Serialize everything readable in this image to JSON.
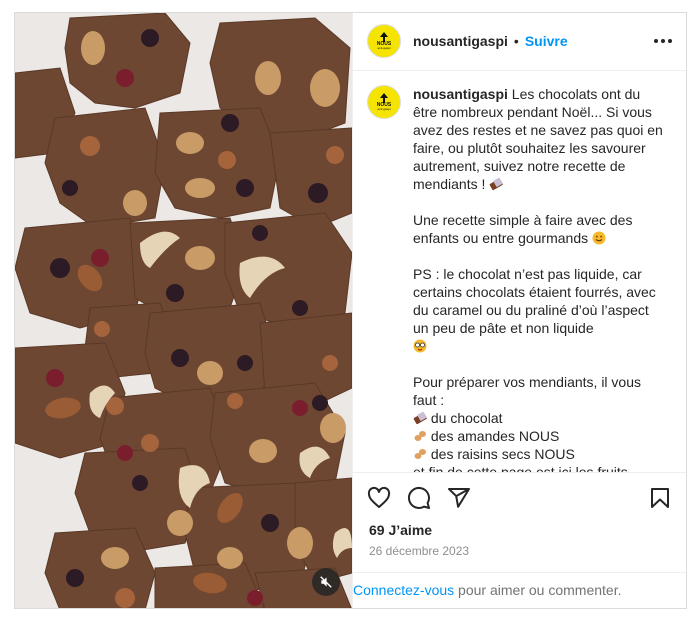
{
  "post": {
    "username": "nousantigaspi",
    "follow_label": "Suivre",
    "avatar_text": "NOUS",
    "avatar_subtext": "anti-gaspi",
    "caption_part1": "Les chocolats ont du être nombreux pendant Noël... Si vous avez des restes et ne savez pas quoi en faire, ou plutôt souhaitez les savourer autrement, suivez notre recette de mendiants ! ",
    "caption_part2": "Une recette simple à faire avec des enfants ou entre gourmands ",
    "caption_part3": "PS : le chocolat n’est pas liquide, car certains chocolats étaient fourrés, avec du caramel ou du praliné d’où l’aspect un peu de pâte et non liquide ",
    "caption_part4": "Pour préparer vos mendiants, il vous faut :",
    "ingredients": [
      "du chocolat",
      "des amandes NOUS",
      "des raisins secs NOUS",
      "et fin de cette page est ici les fruits"
    ],
    "likes": "69 J’aime",
    "date": "26 décembre 2023",
    "login_link": "Connectez-vous",
    "login_rest": " pour aimer ou commenter.",
    "icons": [
      "heart-icon",
      "comment-icon",
      "share-icon",
      "bookmark-icon",
      "more-icon",
      "mute-icon"
    ],
    "colors": {
      "follow": "#0095f6",
      "avatar_bg": "#f4e400",
      "chocolate": "#6b4430"
    }
  }
}
